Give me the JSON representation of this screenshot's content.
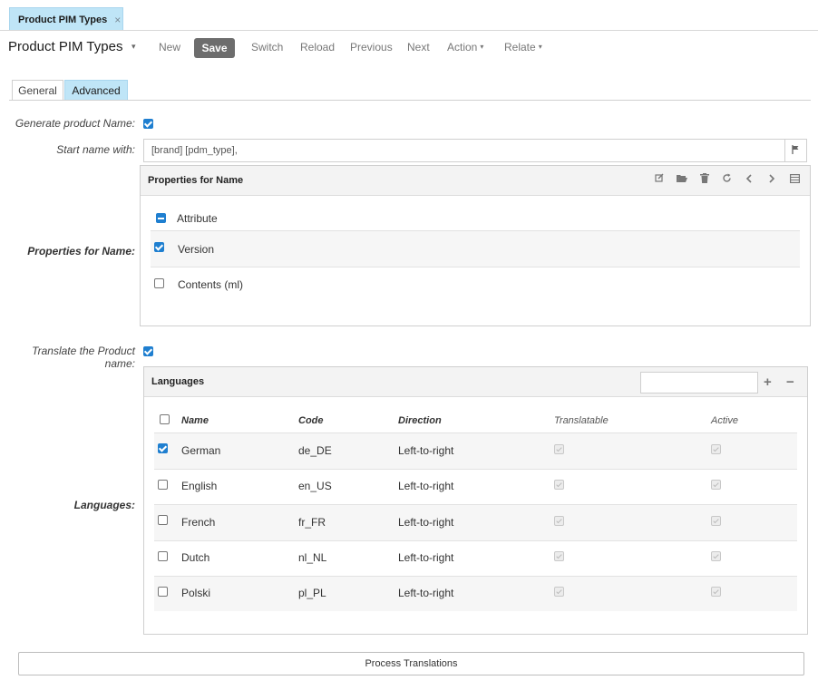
{
  "doc_tab": {
    "label": "Product PIM Types",
    "close": "×"
  },
  "toolbar": {
    "title": "Product PIM Types",
    "title_caret": "▾",
    "new": "New",
    "save": "Save",
    "switch": "Switch",
    "reload": "Reload",
    "previous": "Previous",
    "next": "Next",
    "action": "Action",
    "relate": "Relate",
    "caret": "▾"
  },
  "tabs": {
    "general": "General",
    "advanced": "Advanced"
  },
  "form": {
    "generate_label": "Generate product Name:",
    "start_label": "Start name with:",
    "start_value": "[brand] [pdm_type],",
    "props_label": "Properties for Name:",
    "translate_label": "Translate the Product name:",
    "languages_label": "Languages:"
  },
  "props_panel": {
    "title": "Properties for Name",
    "rows": [
      {
        "label": "Attribute",
        "state": "partial"
      },
      {
        "label": "Version",
        "state": "checked"
      },
      {
        "label": "Contents (ml)",
        "state": "unchecked"
      }
    ]
  },
  "languages_panel": {
    "title": "Languages",
    "add": "+",
    "remove": "−",
    "search_placeholder": "",
    "columns": {
      "name": "Name",
      "code": "Code",
      "direction": "Direction",
      "translatable": "Translatable",
      "active": "Active"
    },
    "rows": [
      {
        "name": "German",
        "code": "de_DE",
        "direction": "Left-to-right",
        "selected": true
      },
      {
        "name": "English",
        "code": "en_US",
        "direction": "Left-to-right",
        "selected": false
      },
      {
        "name": "French",
        "code": "fr_FR",
        "direction": "Left-to-right",
        "selected": false
      },
      {
        "name": "Dutch",
        "code": "nl_NL",
        "direction": "Left-to-right",
        "selected": false
      },
      {
        "name": "Polski",
        "code": "pl_PL",
        "direction": "Left-to-right",
        "selected": false
      }
    ]
  },
  "process_button": "Process Translations",
  "colors": {
    "tab_active": "#bfe5f7",
    "save_button": "#6d6d6d",
    "checkbox_checked": "#1f7fd0"
  }
}
